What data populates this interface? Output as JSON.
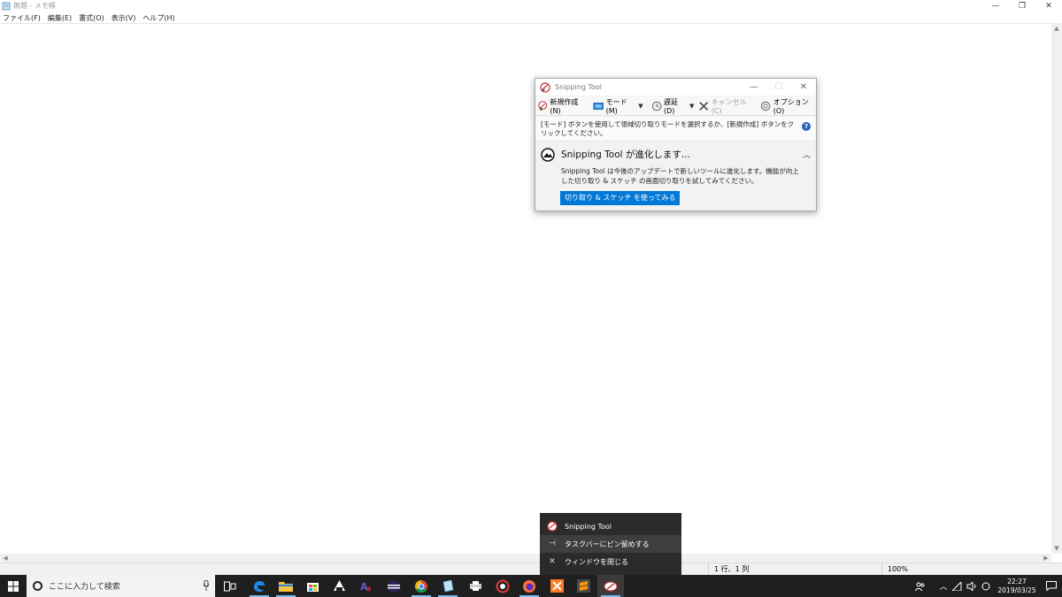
{
  "notepad": {
    "title": "無題 - メモ帳",
    "controls": {
      "minimize": "—",
      "restore": "❐",
      "close": "✕"
    },
    "menu": [
      "ファイル(F)",
      "編集(E)",
      "書式(O)",
      "表示(V)",
      "ヘルプ(H)"
    ],
    "status": {
      "position": "1 行、1 列",
      "zoom": "100%"
    }
  },
  "snipping_tool": {
    "title": "Snipping Tool",
    "toolbar": {
      "new_label": "新規作成(N)",
      "mode_label": "モード(M)",
      "delay_label": "遅延(D)",
      "cancel_label": "キャンセル(C)",
      "options_label": "オプション(O)"
    },
    "info_text": "[モード] ボタンを使用して領域切り取りモードを選択するか、[新規作成] ボタンをクリックしてください。",
    "help_symbol": "?",
    "promo": {
      "title": "Snipping Tool が進化します...",
      "body": "Snipping Tool は今後のアップデートで新しいツールに進化します。機能が向上した切り取り & スケッチ の画面切り取りを試してみてください。",
      "button_label": "切り取り & スケッチ を使ってみる"
    }
  },
  "jumplist": {
    "app_name": "Snipping Tool",
    "pin_label": "タスクバーにピン留めする",
    "close_label": "ウィンドウを閉じる"
  },
  "taskbar": {
    "search_placeholder": "ここに入力して検索",
    "clock_time": "22:27",
    "clock_date": "2019/03/25",
    "colors": {
      "bar": "#1f1f1f",
      "accent": "#0078d7",
      "running": "#76b9ed"
    }
  }
}
